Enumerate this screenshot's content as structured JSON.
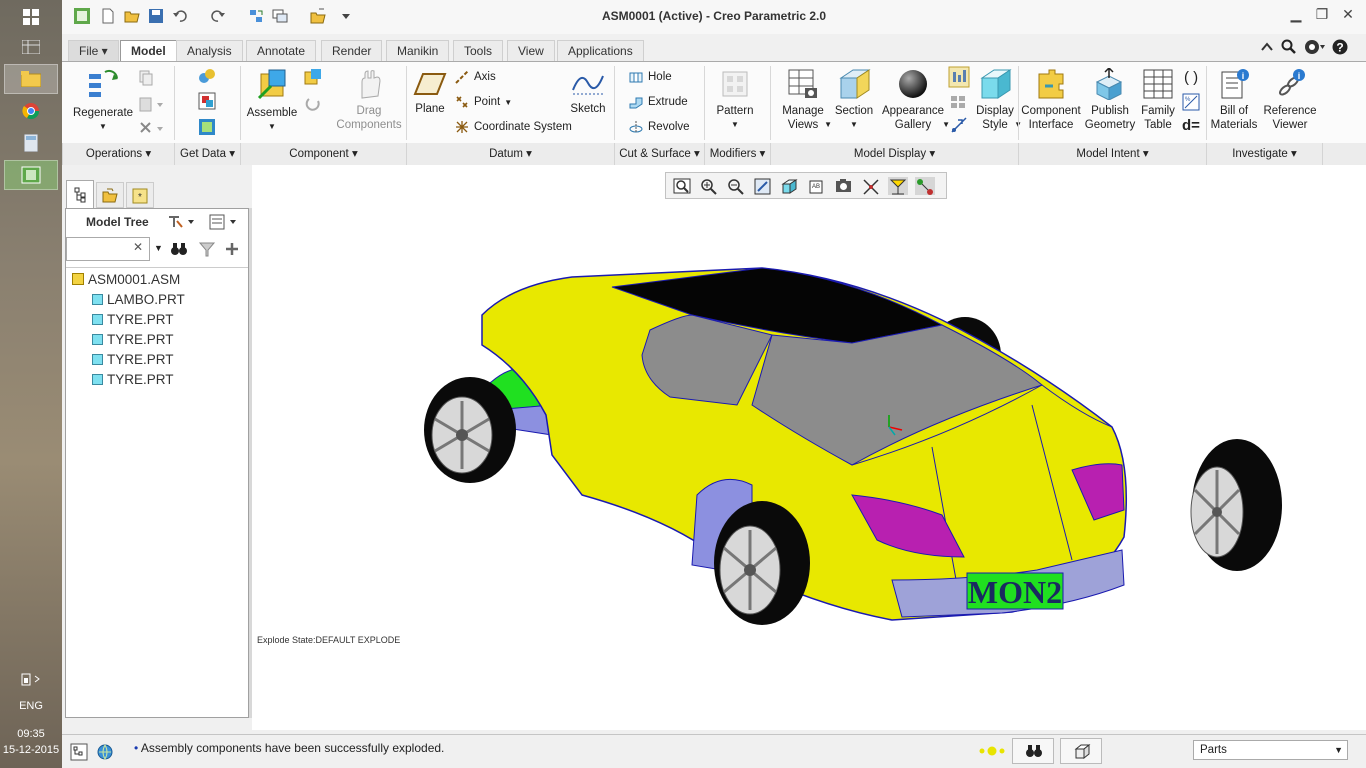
{
  "taskbar": {
    "lang": "ENG",
    "time": "09:35",
    "date": "15-12-2015"
  },
  "window": {
    "title": "ASM0001 (Active) - Creo Parametric 2.0"
  },
  "tabs": [
    {
      "label": "File"
    },
    {
      "label": "Model"
    },
    {
      "label": "Analysis"
    },
    {
      "label": "Annotate"
    },
    {
      "label": "Render"
    },
    {
      "label": "Manikin"
    },
    {
      "label": "Tools"
    },
    {
      "label": "View"
    },
    {
      "label": "Applications"
    }
  ],
  "ribbon": {
    "regenerate": "Regenerate",
    "assemble": "Assemble",
    "drag_components_1": "Drag",
    "drag_components_2": "Components",
    "plane": "Plane",
    "axis": "Axis",
    "point": "Point",
    "coordinate_system": "Coordinate System",
    "sketch": "Sketch",
    "hole": "Hole",
    "extrude": "Extrude",
    "revolve": "Revolve",
    "pattern": "Pattern",
    "manage_views_1": "Manage",
    "manage_views_2": "Views",
    "section": "Section",
    "appearance_gallery_1": "Appearance",
    "appearance_gallery_2": "Gallery",
    "display_style_1": "Display",
    "display_style_2": "Style",
    "component_interface_1": "Component",
    "component_interface_2": "Interface",
    "publish_geometry_1": "Publish",
    "publish_geometry_2": "Geometry",
    "family_table_1": "Family",
    "family_table_2": "Table",
    "bill_of_materials_1": "Bill of",
    "bill_of_materials_2": "Materials",
    "reference_viewer_1": "Reference",
    "reference_viewer_2": "Viewer",
    "d_equals": "d="
  },
  "groups": [
    {
      "label": "Operations"
    },
    {
      "label": "Get Data"
    },
    {
      "label": "Component"
    },
    {
      "label": "Datum"
    },
    {
      "label": "Cut & Surface"
    },
    {
      "label": "Modifiers"
    },
    {
      "label": "Model Display"
    },
    {
      "label": "Model Intent"
    },
    {
      "label": "Investigate"
    }
  ],
  "model_tree": {
    "title": "Model Tree",
    "items": [
      {
        "label": "ASM0001.ASM"
      },
      {
        "label": "LAMBO.PRT"
      },
      {
        "label": "TYRE.PRT"
      },
      {
        "label": "TYRE.PRT"
      },
      {
        "label": "TYRE.PRT"
      },
      {
        "label": "TYRE.PRT"
      }
    ]
  },
  "viewport": {
    "explode_state": "Explode State:DEFAULT EXPLODE",
    "plate_text": "MON2"
  },
  "status": {
    "message": "Assembly components have been successfully exploded.",
    "filter_value": "Parts"
  },
  "colors": {
    "car_body": "#e8e800",
    "glass": "#8c8c8c",
    "roof": "#050505",
    "headlight": "#b820b0",
    "plate": "#20e020",
    "tyre": "#0a0a0a",
    "edge": "#1a1ab0"
  }
}
